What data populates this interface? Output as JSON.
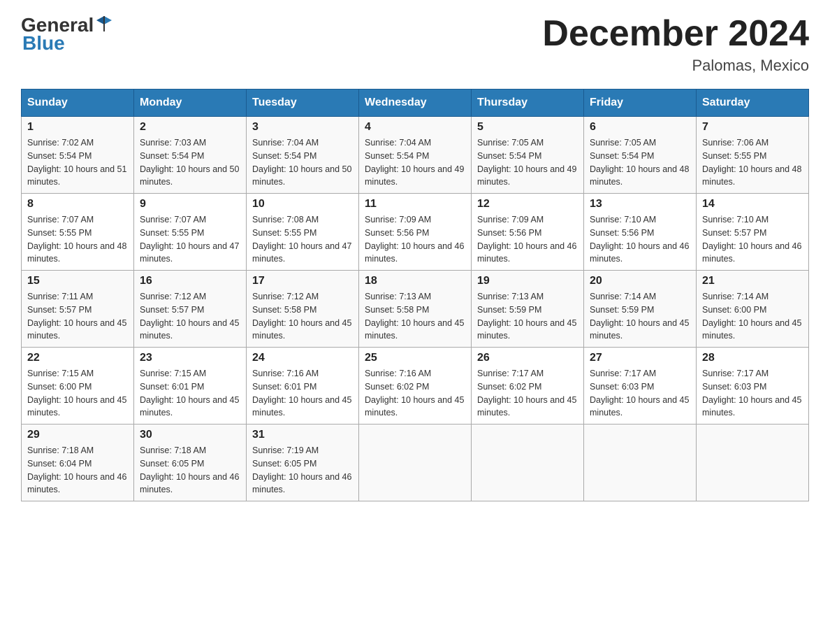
{
  "header": {
    "logo_general": "General",
    "logo_blue": "Blue",
    "month_title": "December 2024",
    "location": "Palomas, Mexico"
  },
  "weekdays": [
    "Sunday",
    "Monday",
    "Tuesday",
    "Wednesday",
    "Thursday",
    "Friday",
    "Saturday"
  ],
  "weeks": [
    [
      {
        "day": "1",
        "sunrise": "7:02 AM",
        "sunset": "5:54 PM",
        "daylight": "10 hours and 51 minutes."
      },
      {
        "day": "2",
        "sunrise": "7:03 AM",
        "sunset": "5:54 PM",
        "daylight": "10 hours and 50 minutes."
      },
      {
        "day": "3",
        "sunrise": "7:04 AM",
        "sunset": "5:54 PM",
        "daylight": "10 hours and 50 minutes."
      },
      {
        "day": "4",
        "sunrise": "7:04 AM",
        "sunset": "5:54 PM",
        "daylight": "10 hours and 49 minutes."
      },
      {
        "day": "5",
        "sunrise": "7:05 AM",
        "sunset": "5:54 PM",
        "daylight": "10 hours and 49 minutes."
      },
      {
        "day": "6",
        "sunrise": "7:05 AM",
        "sunset": "5:54 PM",
        "daylight": "10 hours and 48 minutes."
      },
      {
        "day": "7",
        "sunrise": "7:06 AM",
        "sunset": "5:55 PM",
        "daylight": "10 hours and 48 minutes."
      }
    ],
    [
      {
        "day": "8",
        "sunrise": "7:07 AM",
        "sunset": "5:55 PM",
        "daylight": "10 hours and 48 minutes."
      },
      {
        "day": "9",
        "sunrise": "7:07 AM",
        "sunset": "5:55 PM",
        "daylight": "10 hours and 47 minutes."
      },
      {
        "day": "10",
        "sunrise": "7:08 AM",
        "sunset": "5:55 PM",
        "daylight": "10 hours and 47 minutes."
      },
      {
        "day": "11",
        "sunrise": "7:09 AM",
        "sunset": "5:56 PM",
        "daylight": "10 hours and 46 minutes."
      },
      {
        "day": "12",
        "sunrise": "7:09 AM",
        "sunset": "5:56 PM",
        "daylight": "10 hours and 46 minutes."
      },
      {
        "day": "13",
        "sunrise": "7:10 AM",
        "sunset": "5:56 PM",
        "daylight": "10 hours and 46 minutes."
      },
      {
        "day": "14",
        "sunrise": "7:10 AM",
        "sunset": "5:57 PM",
        "daylight": "10 hours and 46 minutes."
      }
    ],
    [
      {
        "day": "15",
        "sunrise": "7:11 AM",
        "sunset": "5:57 PM",
        "daylight": "10 hours and 45 minutes."
      },
      {
        "day": "16",
        "sunrise": "7:12 AM",
        "sunset": "5:57 PM",
        "daylight": "10 hours and 45 minutes."
      },
      {
        "day": "17",
        "sunrise": "7:12 AM",
        "sunset": "5:58 PM",
        "daylight": "10 hours and 45 minutes."
      },
      {
        "day": "18",
        "sunrise": "7:13 AM",
        "sunset": "5:58 PM",
        "daylight": "10 hours and 45 minutes."
      },
      {
        "day": "19",
        "sunrise": "7:13 AM",
        "sunset": "5:59 PM",
        "daylight": "10 hours and 45 minutes."
      },
      {
        "day": "20",
        "sunrise": "7:14 AM",
        "sunset": "5:59 PM",
        "daylight": "10 hours and 45 minutes."
      },
      {
        "day": "21",
        "sunrise": "7:14 AM",
        "sunset": "6:00 PM",
        "daylight": "10 hours and 45 minutes."
      }
    ],
    [
      {
        "day": "22",
        "sunrise": "7:15 AM",
        "sunset": "6:00 PM",
        "daylight": "10 hours and 45 minutes."
      },
      {
        "day": "23",
        "sunrise": "7:15 AM",
        "sunset": "6:01 PM",
        "daylight": "10 hours and 45 minutes."
      },
      {
        "day": "24",
        "sunrise": "7:16 AM",
        "sunset": "6:01 PM",
        "daylight": "10 hours and 45 minutes."
      },
      {
        "day": "25",
        "sunrise": "7:16 AM",
        "sunset": "6:02 PM",
        "daylight": "10 hours and 45 minutes."
      },
      {
        "day": "26",
        "sunrise": "7:17 AM",
        "sunset": "6:02 PM",
        "daylight": "10 hours and 45 minutes."
      },
      {
        "day": "27",
        "sunrise": "7:17 AM",
        "sunset": "6:03 PM",
        "daylight": "10 hours and 45 minutes."
      },
      {
        "day": "28",
        "sunrise": "7:17 AM",
        "sunset": "6:03 PM",
        "daylight": "10 hours and 45 minutes."
      }
    ],
    [
      {
        "day": "29",
        "sunrise": "7:18 AM",
        "sunset": "6:04 PM",
        "daylight": "10 hours and 46 minutes."
      },
      {
        "day": "30",
        "sunrise": "7:18 AM",
        "sunset": "6:05 PM",
        "daylight": "10 hours and 46 minutes."
      },
      {
        "day": "31",
        "sunrise": "7:19 AM",
        "sunset": "6:05 PM",
        "daylight": "10 hours and 46 minutes."
      },
      null,
      null,
      null,
      null
    ]
  ]
}
